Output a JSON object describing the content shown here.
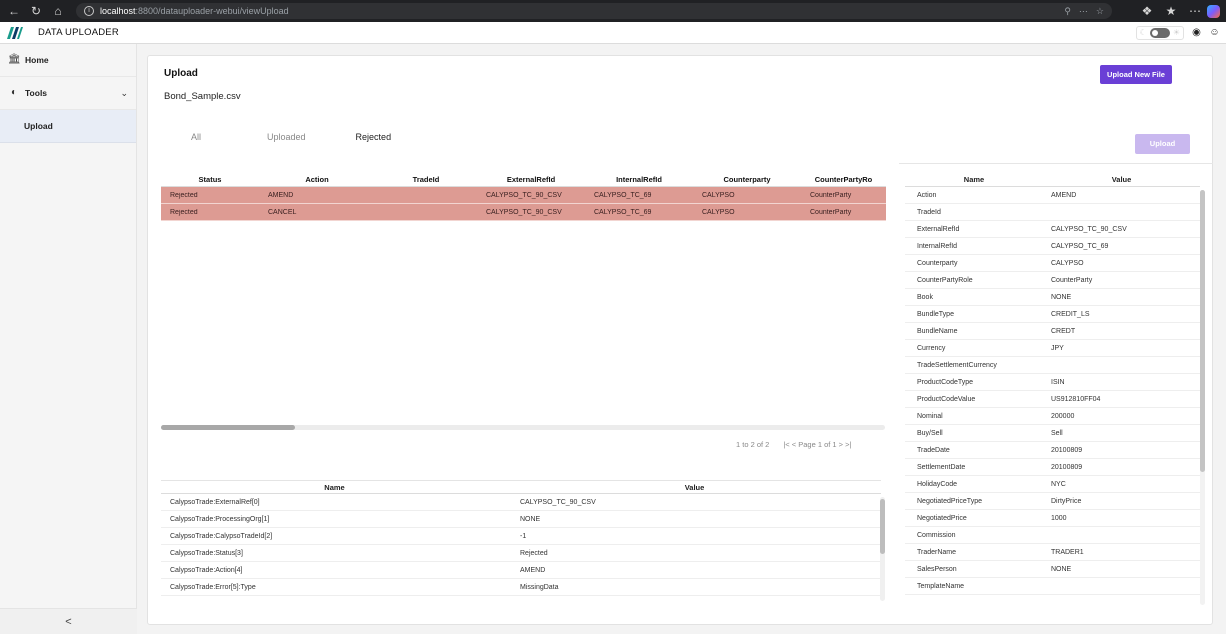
{
  "browser": {
    "url_host": "localhost",
    "url_rest": ":8800/datauploader-webui/viewUpload"
  },
  "app": {
    "title": "DATA UPLOADER"
  },
  "sidebar": {
    "items": [
      {
        "label": "Home",
        "icon": "bank-icon"
      },
      {
        "label": "Tools",
        "icon": "gauge-icon"
      }
    ],
    "sub_item": "Upload",
    "collapse_glyph": "<"
  },
  "page": {
    "title": "Upload",
    "file_name": "Bond_Sample.csv",
    "upload_new_label": "Upload New File",
    "upload_label": "Upload",
    "tabs": [
      "All",
      "Uploaded",
      "Rejected"
    ],
    "active_tab": "Rejected"
  },
  "grid": {
    "columns": [
      "Status",
      "Action",
      "TradeId",
      "ExternalRefId",
      "InternalRefId",
      "Counterparty",
      "CounterPartyRo"
    ],
    "rows": [
      [
        "Rejected",
        "AMEND",
        "",
        "CALYPSO_TC_90_CSV",
        "CALYPSO_TC_69",
        "CALYPSO",
        "CounterParty"
      ],
      [
        "Rejected",
        "CANCEL",
        "",
        "CALYPSO_TC_90_CSV",
        "CALYPSO_TC_69",
        "CALYPSO",
        "CounterParty"
      ]
    ],
    "row_color": "#dd9b93",
    "pager_count": "1 to 2 of 2",
    "pager_nav": "|< < Page 1 of 1 > >|"
  },
  "details": {
    "header_name": "Name",
    "header_value": "Value",
    "rows": [
      [
        "CalypsoTrade:ExternalRef[0]",
        "CALYPSO_TC_90_CSV"
      ],
      [
        "CalypsoTrade:ProcessingOrg[1]",
        "NONE"
      ],
      [
        "CalypsoTrade:CalypsoTradeId[2]",
        "-1"
      ],
      [
        "CalypsoTrade:Status[3]",
        "Rejected"
      ],
      [
        "CalypsoTrade:Action[4]",
        "AMEND"
      ],
      [
        "CalypsoTrade:Error[5]:Type",
        "MissingData"
      ]
    ]
  },
  "side_table": {
    "header_name": "Name",
    "header_value": "Value",
    "rows": [
      [
        "Action",
        "AMEND"
      ],
      [
        "TradeId",
        ""
      ],
      [
        "ExternalRefId",
        "CALYPSO_TC_90_CSV"
      ],
      [
        "InternalRefId",
        "CALYPSO_TC_69"
      ],
      [
        "Counterparty",
        "CALYPSO"
      ],
      [
        "CounterPartyRole",
        "CounterParty"
      ],
      [
        "Book",
        "NONE"
      ],
      [
        "BundleType",
        "CREDIT_LS"
      ],
      [
        "BundleName",
        "CREDT"
      ],
      [
        "Currency",
        "JPY"
      ],
      [
        "TradeSettlementCurrency",
        ""
      ],
      [
        "ProductCodeType",
        "ISIN"
      ],
      [
        "ProductCodeValue",
        "US912810FF04"
      ],
      [
        "Nominal",
        "200000"
      ],
      [
        "Buy/Sell",
        "Sell"
      ],
      [
        "TradeDate",
        "20100809"
      ],
      [
        "SettlementDate",
        "20100809"
      ],
      [
        "HolidayCode",
        "NYC"
      ],
      [
        "NegotiatedPriceType",
        "DirtyPrice"
      ],
      [
        "NegotiatedPrice",
        "1000"
      ],
      [
        "Commission",
        ""
      ],
      [
        "TraderName",
        "TRADER1"
      ],
      [
        "SalesPerson",
        "NONE"
      ],
      [
        "TemplateName",
        ""
      ]
    ]
  }
}
